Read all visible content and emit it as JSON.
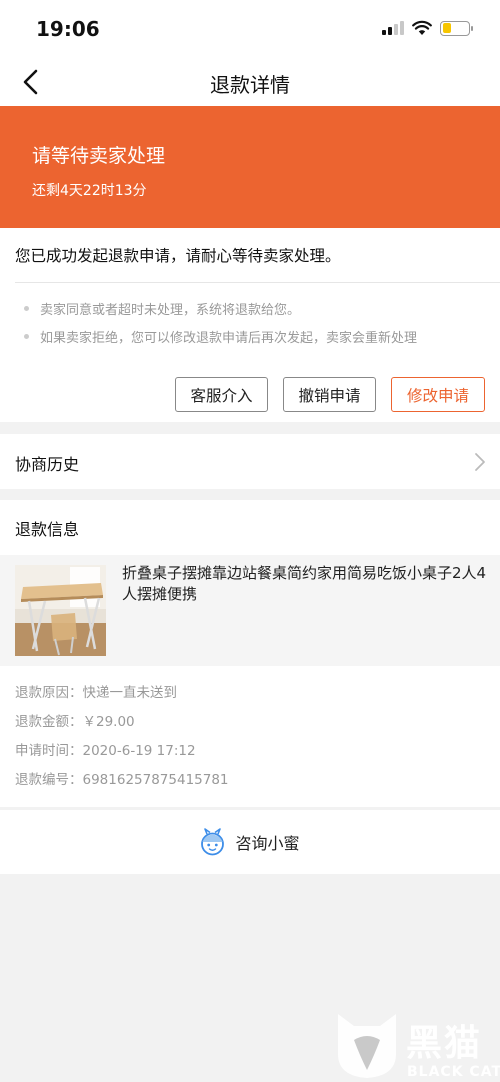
{
  "status_bar": {
    "time": "19:06"
  },
  "nav": {
    "title": "退款详情"
  },
  "banner": {
    "title": "请等待卖家处理",
    "subtitle": "还剩4天22时13分"
  },
  "status_card": {
    "message": "您已成功发起退款申请，请耐心等待卖家处理。",
    "tips": [
      "卖家同意或者超时未处理，系统将退款给您。",
      "如果卖家拒绝，您可以修改退款申请后再次发起，卖家会重新处理"
    ],
    "buttons": {
      "service": "客服介入",
      "cancel": "撤销申请",
      "modify": "修改申请"
    }
  },
  "history": {
    "label": "协商历史"
  },
  "refund_info": {
    "title": "退款信息",
    "product_name": "折叠桌子摆摊靠边站餐桌简约家用简易吃饭小桌子2人4人摆摊便携",
    "rows": [
      {
        "label": "退款原因：",
        "value": "快递一直未送到"
      },
      {
        "label": "退款金额：",
        "value": "￥29.00"
      },
      {
        "label": "申请时间：",
        "value": "2020-6-19 17:12"
      },
      {
        "label": "退款编号：",
        "value": "69816257875415781"
      }
    ]
  },
  "consult": {
    "label": "咨询小蜜"
  },
  "watermark": {
    "cn": "黑猫",
    "en": "BLACK CAT"
  },
  "colors": {
    "accent": "#ec6430",
    "background": "#f2f2f2"
  }
}
